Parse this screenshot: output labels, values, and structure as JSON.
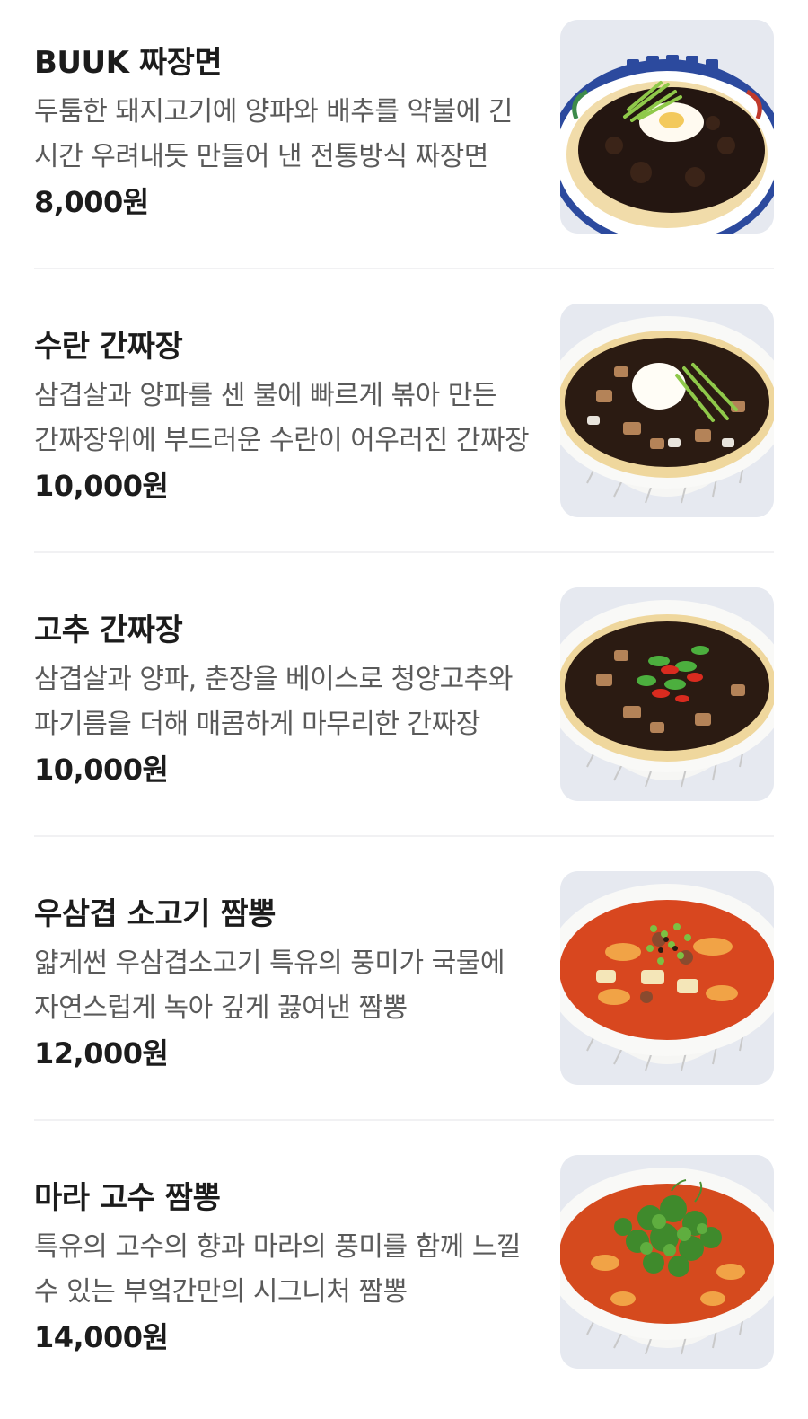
{
  "menu": {
    "items": [
      {
        "name": "BUUK 짜장면",
        "description": "두툼한 돼지고기에 양파와 배추를 약불에 긴 시간 우려내듯 만들어 낸 전통방식 짜장면",
        "price": "8,000원",
        "image": "jjajangmyeon-bowl"
      },
      {
        "name": "수란 간짜장",
        "description": "삼겹살과 양파를 센 불에 빠르게 볶아 만든 간짜장위에 부드러운 수란이 어우러진 간짜장",
        "price": "10,000원",
        "image": "poached-egg-ganjjajang-bowl"
      },
      {
        "name": "고추 간짜장",
        "description": "삼겹살과 양파, 춘장을 베이스로 청양고추와 파기름을 더해 매콤하게 마무리한 간짜장",
        "price": "10,000원",
        "image": "chili-ganjjajang-bowl"
      },
      {
        "name": "우삼겹 소고기 짬뽕",
        "description": "얇게썬 우삼겹소고기 특유의 풍미가 국물에 자연스럽게 녹아 깊게 끓여낸 짬뽕",
        "price": "12,000원",
        "image": "beef-jjamppong-bowl"
      },
      {
        "name": "마라 고수 짬뽕",
        "description": "특유의 고수의 향과 마라의 풍미를 함께 느낄 수 있는 부엌간만의 시그니처 짬뽕",
        "price": "14,000원",
        "image": "mala-coriander-jjamppong-bowl"
      }
    ]
  }
}
